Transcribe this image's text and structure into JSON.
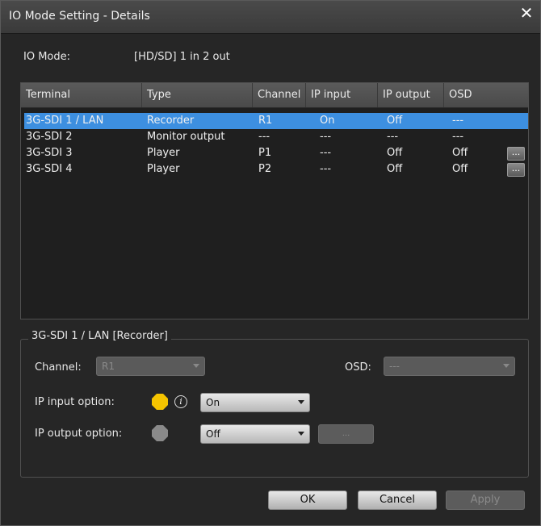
{
  "window": {
    "title": "IO Mode Setting - Details",
    "close_glyph": "✕"
  },
  "io_mode": {
    "label": "IO Mode:",
    "value": "[HD/SD] 1 in 2 out"
  },
  "table": {
    "headers": [
      "Terminal",
      "Type",
      "Channel",
      "IP input",
      "IP output",
      "OSD"
    ],
    "rows": [
      {
        "terminal": "3G-SDI 1 / LAN",
        "type": "Recorder",
        "channel": "R1",
        "ip_input": "On",
        "ip_output": "Off",
        "osd": "---",
        "has_button": false,
        "selected": true
      },
      {
        "terminal": "3G-SDI 2",
        "type": "Monitor output",
        "channel": "---",
        "ip_input": "---",
        "ip_output": "---",
        "osd": "---",
        "has_button": false,
        "selected": false
      },
      {
        "terminal": "3G-SDI 3",
        "type": "Player",
        "channel": "P1",
        "ip_input": "---",
        "ip_output": "Off",
        "osd": "Off",
        "has_button": true,
        "selected": false
      },
      {
        "terminal": "3G-SDI 4",
        "type": "Player",
        "channel": "P2",
        "ip_input": "---",
        "ip_output": "Off",
        "osd": "Off",
        "has_button": true,
        "selected": false
      }
    ],
    "row_button_label": "..."
  },
  "details": {
    "group_title": "3G-SDI 1 / LAN [Recorder]",
    "channel_label": "Channel:",
    "channel_value": "R1",
    "osd_label": "OSD:",
    "osd_value": "---",
    "ip_input_label": "IP input option:",
    "ip_input_value": "On",
    "ip_input_indicator_color": "#f5c400",
    "info_glyph": "i",
    "ip_output_label": "IP output option:",
    "ip_output_value": "Off",
    "ip_output_indicator_color": "#8a8a8a",
    "ip_output_button_label": "..."
  },
  "buttons": {
    "ok": "OK",
    "cancel": "Cancel",
    "apply": "Apply"
  }
}
